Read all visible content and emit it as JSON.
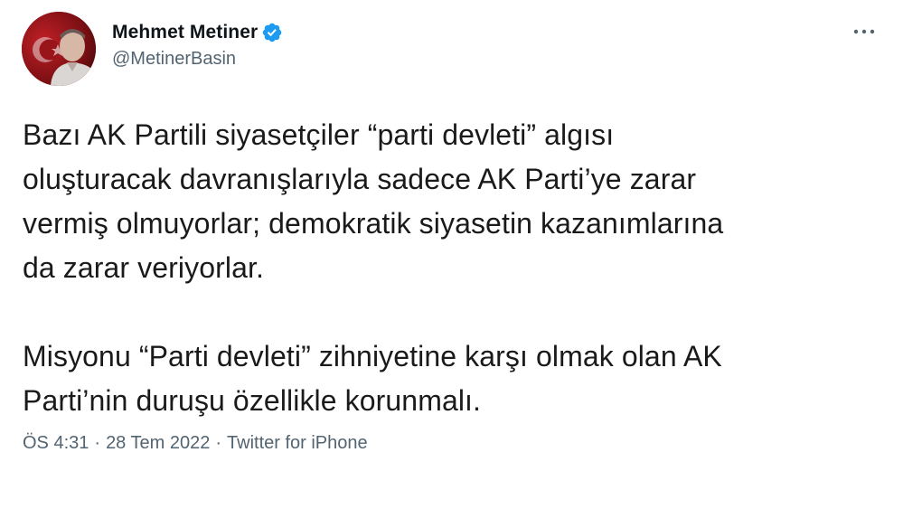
{
  "author": {
    "display_name": "Mehmet Metiner",
    "handle": "@MetinerBasin",
    "verified": true
  },
  "more_menu": {
    "icon": "more-horizontal-icon"
  },
  "tweet": {
    "paragraph_1": "Bazı AK Partili siyasetçiler “parti devleti” algısı\noluşturacak davranışlarıyla sadece AK Parti’ye zarar\nvermiş olmuyorlar; demokratik siyasetin kazanımlarına\nda zarar veriyorlar.",
    "paragraph_2": "Misyonu “Parti devleti” zihniyetine karşı olmak olan AK\nParti’nin duruşu özellikle korunmalı."
  },
  "meta": {
    "time": "ÖS 4:31",
    "separator": "·",
    "date": "28 Tem 2022",
    "source": "Twitter for iPhone"
  },
  "colors": {
    "verified_badge": "#1d9bf0",
    "secondary_text": "#536471",
    "primary_text": "#0f1419",
    "avatar_bg": "#8e1418"
  }
}
